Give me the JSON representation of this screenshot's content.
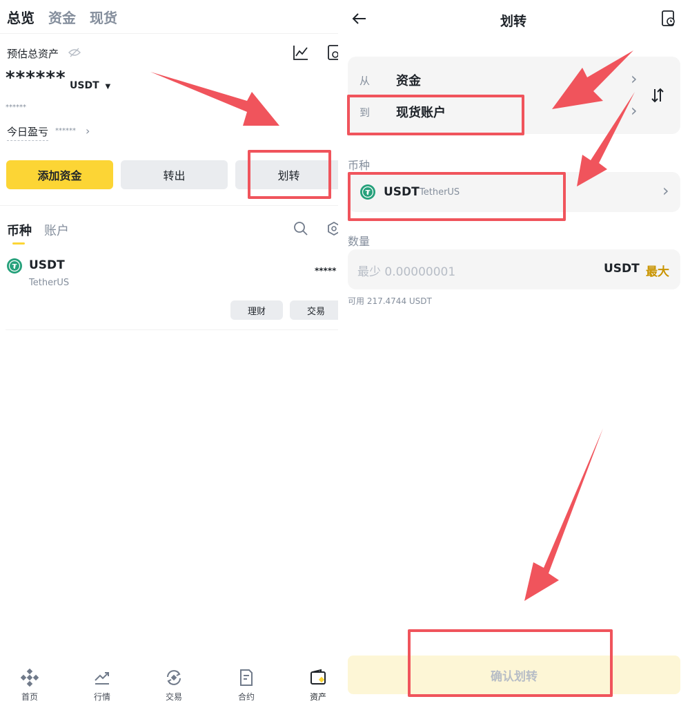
{
  "left": {
    "tabs": [
      "总览",
      "资金",
      "现货"
    ],
    "est_label": "预估总资产",
    "balance_masked": "******",
    "currency": "USDT",
    "sub_masked": "******",
    "pnl_label": "今日盈亏",
    "pnl_masked": "******",
    "buttons": {
      "add": "添加资金",
      "withdraw": "转出",
      "transfer": "划转"
    },
    "list_tabs": [
      "币种",
      "账户"
    ],
    "asset": {
      "symbol": "USDT",
      "name": "TetherUS",
      "amount_masked": "*****"
    },
    "asset_actions": [
      "理财",
      "交易"
    ],
    "nav": [
      "首页",
      "行情",
      "交易",
      "合约",
      "资产"
    ]
  },
  "right": {
    "title": "划转",
    "from_label": "从",
    "from_value": "资金",
    "to_label": "到",
    "to_value": "现货账户",
    "coin_label": "币种",
    "coin_symbol": "USDT",
    "coin_name": "TetherUS",
    "amount_label": "数量",
    "amount_placeholder": "最少 0.00000001",
    "amount_unit": "USDT",
    "max_label": "最大",
    "available": "可用 217.4744 USDT",
    "confirm": "确认划转"
  },
  "colors": {
    "accent": "#fcd535",
    "annotation": "#f0545c",
    "tether": "#26a17b",
    "gold": "#c99400"
  }
}
